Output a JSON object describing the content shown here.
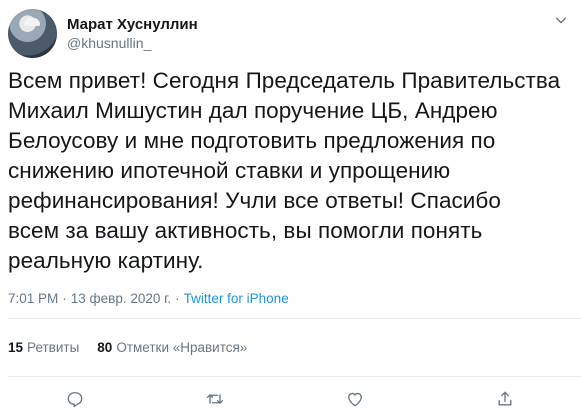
{
  "author": {
    "display_name": "Марат Хуснуллин",
    "handle": "@khusnullin_"
  },
  "tweet": {
    "text": "Всем привет! Сегодня Председатель Правительства\nМихаил Мишустин дал поручение ЦБ, Андрею\nБелоусову и мне подготовить предложения по\nснижению ипотечной ставки и  упрощению\nрефинансирования! Учли все ответы! Спасибо\nвсем за вашу активность, вы помогли понять\nреальную картину.",
    "time": "7:01 PM",
    "separator1": "·",
    "date": "13 февр. 2020 г.",
    "separator2": "·",
    "source": "Twitter for iPhone"
  },
  "stats": {
    "retweets_count": "15",
    "retweets_label": "Ретвиты",
    "likes_count": "80",
    "likes_label": "Отметки «Нравится»"
  },
  "icons": {
    "menu": "chevron-down-icon",
    "reply": "reply-icon",
    "retweet": "retweet-icon",
    "like": "heart-icon",
    "share": "share-icon"
  },
  "colors": {
    "link": "#1b95e0",
    "muted": "#657786",
    "text": "#14171a",
    "divider": "#e6ecf0"
  }
}
